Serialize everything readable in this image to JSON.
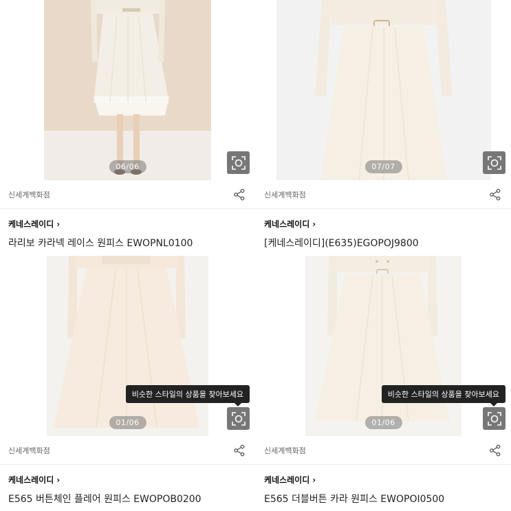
{
  "products": [
    {
      "counter": "06/06",
      "store": "신세계백화점",
      "brand": "케네스레이디",
      "name": "라리보 카라넥 레이스 원피스 EWOPNL0100",
      "tooltip": null
    },
    {
      "counter": "07/07",
      "store": "신세계백화점",
      "brand": "케네스레이디",
      "name": "[케네스레이디](E635)EGOPOJ9800",
      "tooltip": null
    },
    {
      "counter": "01/06",
      "store": "신세계백화점",
      "brand": "케네스레이디",
      "name": "E565 버튼체인 플레어 원피스 EWOPOB0200",
      "tooltip": "비슷한 스타일의 상품을 찾아보세요"
    },
    {
      "counter": "01/06",
      "store": "신세계백화점",
      "brand": "케네스레이디",
      "name": "E565 더블버튼 카라 원피스 EWOPOI0500",
      "tooltip": "비슷한 스타일의 상품을 찾아보세요"
    }
  ]
}
